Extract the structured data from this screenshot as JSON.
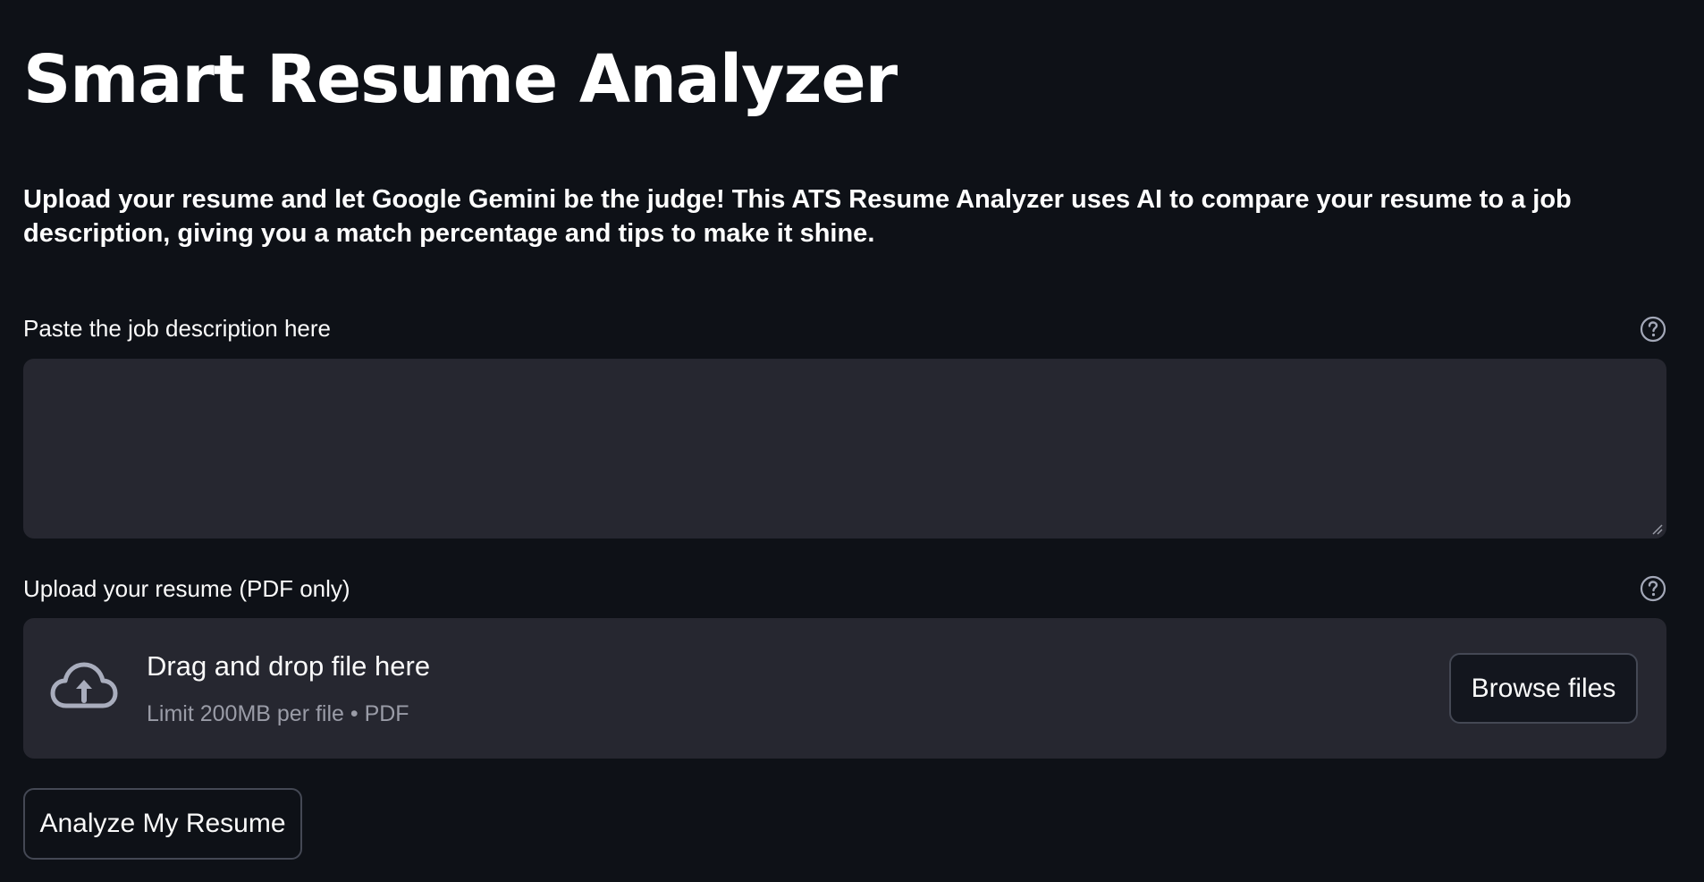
{
  "page": {
    "title": "Smart Resume Analyzer",
    "subtitle": "Upload your resume and let Google Gemini be the judge! This ATS Resume Analyzer uses AI to compare your resume to a job description, giving you a match percentage and tips to make it shine."
  },
  "job_description": {
    "label": "Paste the job description here",
    "value": "",
    "placeholder": "",
    "help_icon": "question-circle-icon"
  },
  "resume_upload": {
    "label": "Upload your resume (PDF only)",
    "help_icon": "question-circle-icon",
    "dropzone_icon": "cloud-upload-icon",
    "drop_text": "Drag and drop file here",
    "limit_text": "Limit 200MB per file • PDF",
    "browse_label": "Browse files"
  },
  "actions": {
    "analyze_label": "Analyze My Resume"
  },
  "colors": {
    "background": "#0e1117",
    "surface": "#262730",
    "text": "#fafafa",
    "muted_text": "#9a9ca7",
    "border": "#444854"
  }
}
